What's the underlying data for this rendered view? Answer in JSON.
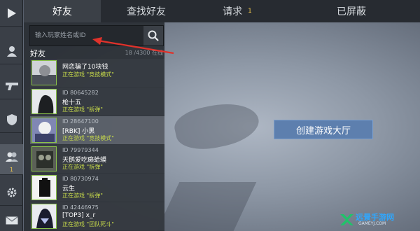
{
  "tabs": [
    {
      "label": "好友"
    },
    {
      "label": "查找好友"
    },
    {
      "label": "请求",
      "count": "1"
    },
    {
      "label": "已屏蔽"
    }
  ],
  "sidebar": {
    "items": [
      {
        "icon": "play-icon"
      },
      {
        "icon": "profile-icon"
      },
      {
        "icon": "gun-icon"
      },
      {
        "icon": "shield-icon"
      },
      {
        "icon": "friends-icon",
        "badge": "1"
      },
      {
        "icon": "gear-icon"
      },
      {
        "icon": "mail-icon"
      }
    ]
  },
  "search": {
    "placeholder": "输入玩家姓名或ID"
  },
  "friends": {
    "title": "好友",
    "online_count": "18 /4300 在线",
    "rows": [
      {
        "id": "",
        "name": "网恋骗了10块钱",
        "status": "正在游戏 \"竞技模式\""
      },
      {
        "id": "ID 80645282",
        "name": "枪十五",
        "status": "正在游戏 \"拆弹\""
      },
      {
        "id": "ID 28647100",
        "name": "[RBK] 小黑",
        "status": "正在游戏 \"竞技模式\""
      },
      {
        "id": "ID 79979344",
        "name": "天鹅爱吃癞蛤蟆",
        "status": "正在游戏 \"拆弹\""
      },
      {
        "id": "ID 80730974",
        "name": "云生",
        "status": "正在游戏 \"拆弹\""
      },
      {
        "id": "ID 42446975",
        "name": "[TOP3] x_r",
        "status": "正在游戏 \"团队死斗\""
      }
    ]
  },
  "main": {
    "create_lobby_label": "创建游戏大厅"
  },
  "watermark": {
    "name": "远景手游网",
    "url": "GAMEYJ.COM"
  },
  "colors": {
    "accent": "#5d7fae",
    "status": "#c6d94a",
    "badge": "#f2c94c",
    "annotation": "#e0322b"
  }
}
